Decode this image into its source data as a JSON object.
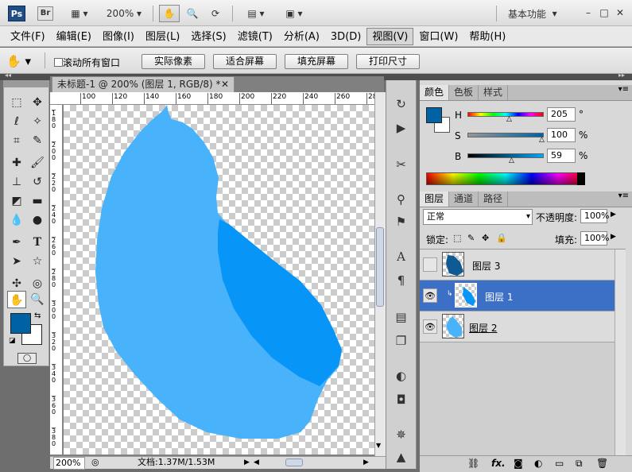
{
  "topbar": {
    "ps_label": "Ps",
    "br_label": "Br",
    "zoom": "200%",
    "workspace": "基本功能"
  },
  "menu": [
    "文件(F)",
    "编辑(E)",
    "图像(I)",
    "图层(L)",
    "选择(S)",
    "滤镜(T)",
    "分析(A)",
    "3D(D)",
    "视图(V)",
    "窗口(W)",
    "帮助(H)"
  ],
  "options": {
    "scroll_all": "滚动所有窗口",
    "actual_pixels": "实际像素",
    "fit_screen": "适合屏幕",
    "fill_screen": "填充屏幕",
    "print_size": "打印尺寸"
  },
  "document": {
    "tab_title": "未标题-1 @ 200% (图层 1, RGB/8) *",
    "ruler_h": [
      "100",
      "120",
      "140",
      "160",
      "180",
      "200",
      "220",
      "240",
      "260",
      "28"
    ],
    "ruler_v": [
      "1\n8\n0",
      "2\n0\n0",
      "2\n2\n0",
      "2\n4\n0",
      "2\n6\n0",
      "2\n8\n0",
      "3\n0\n0",
      "3\n2\n0",
      "3\n4\n0",
      "3\n6\n0",
      "3\n8\n0"
    ],
    "status_zoom": "200%",
    "status_doc": "文档:1.37M/1.53M"
  },
  "color_panel": {
    "tabs": [
      "颜色",
      "色板",
      "样式"
    ],
    "h_label": "H",
    "h_value": "205",
    "h_unit": "°",
    "s_label": "S",
    "s_value": "100",
    "s_unit": "%",
    "b_label": "B",
    "b_value": "59",
    "b_unit": "%",
    "foreground": "#0062a3"
  },
  "layers_panel": {
    "tabs": [
      "图层",
      "通道",
      "路径"
    ],
    "blend_mode": "正常",
    "opacity_label": "不透明度:",
    "opacity_value": "100%",
    "lock_label": "锁定:",
    "fill_label": "填充:",
    "fill_value": "100%",
    "layers": [
      {
        "name": "图层 3",
        "visible": false,
        "selected": false
      },
      {
        "name": "图层 1",
        "visible": true,
        "selected": true
      },
      {
        "name": "图层 2",
        "visible": true,
        "selected": false
      }
    ]
  },
  "colors": {
    "light_blue": "#48b2fb",
    "dark_blue": "#0795f8",
    "selection": "#3c6fc6"
  }
}
